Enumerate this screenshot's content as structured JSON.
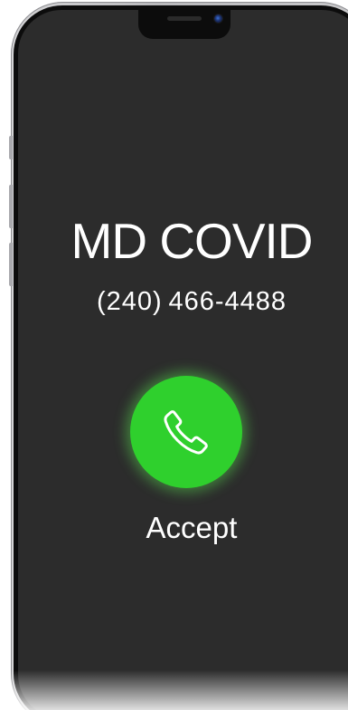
{
  "call": {
    "caller_name": "MD COVID",
    "caller_number": "(240) 466-4488",
    "accept_label": "Accept"
  },
  "icons": {
    "accept": "phone-handset-icon",
    "camera": "front-camera-icon",
    "speaker": "speaker-grille-icon"
  },
  "colors": {
    "screen_background": "#2c2c2c",
    "accept_green": "#2fd02d",
    "text": "#ffffff",
    "bezel": "#0c0c0c"
  }
}
